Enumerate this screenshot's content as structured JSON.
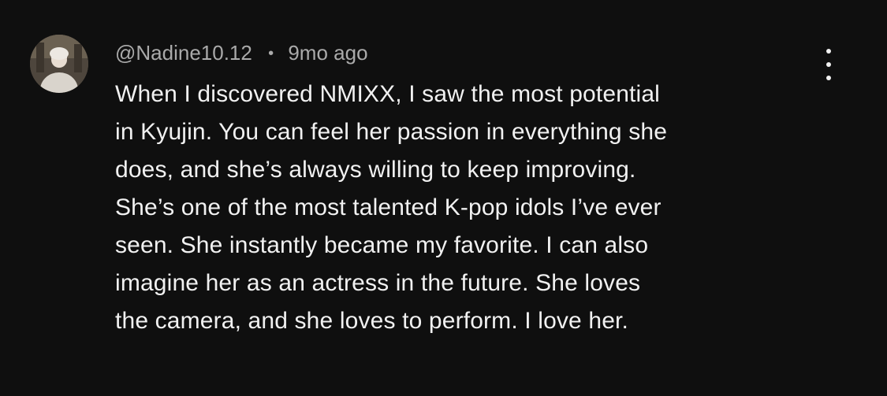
{
  "comment": {
    "author": "@Nadine10.12",
    "separator": "•",
    "time_ago": "9mo ago",
    "avatar_icon": "user-avatar-icon",
    "menu_icon": "more-vertical-icon",
    "text_lines": [
      "When I discovered NMIXX, I saw the most potential",
      "in Kyujin. You can feel her passion in everything she",
      "does, and she’s always willing to keep improving.",
      "She’s one of the most talented K-pop idols I’ve ever",
      "seen. She instantly became my favorite. I can also",
      "imagine her as an actress in the future. She loves",
      "the camera, and she loves to perform. I love her."
    ]
  },
  "colors": {
    "background": "#0f0f0f",
    "primary_text": "#f1f1f1",
    "secondary_text": "#aaaaaa"
  }
}
